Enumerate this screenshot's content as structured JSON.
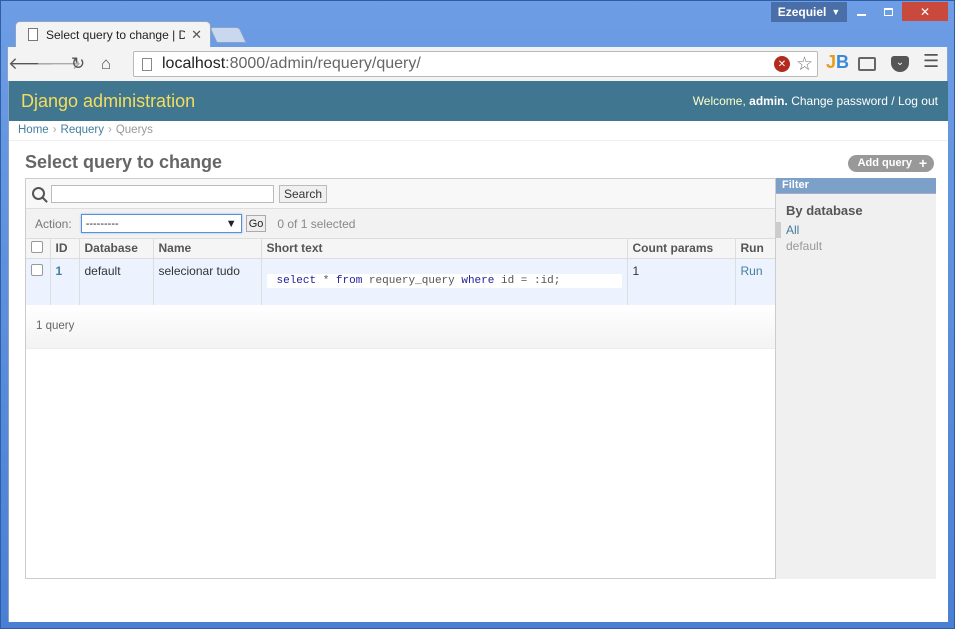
{
  "browser": {
    "user": "Ezequiel",
    "tab_title": "Select query to change | D",
    "url_host": "localhost",
    "url_rest": ":8000/admin/requery/query/"
  },
  "header": {
    "brand": "Django administration",
    "welcome": "Welcome,",
    "username": "admin.",
    "change_password": "Change password",
    "separator": "/",
    "logout": "Log out"
  },
  "breadcrumbs": {
    "home": "Home",
    "app": "Requery",
    "current": "Querys",
    "sep": "›"
  },
  "page": {
    "title": "Select query to change",
    "add_label": "Add query",
    "add_icon": "+"
  },
  "search": {
    "value": "",
    "button": "Search"
  },
  "actions": {
    "label": "Action:",
    "selected": "---------",
    "go": "Go",
    "counter": "0 of 1 selected"
  },
  "table": {
    "columns": [
      "ID",
      "Database",
      "Name",
      "Short text",
      "Count params",
      "Run"
    ],
    "rows": [
      {
        "id": "1",
        "database": "default",
        "name": "selecionar tudo",
        "code_tokens": [
          "select",
          " * ",
          "from",
          " requery_query ",
          "where",
          " id = :id;"
        ],
        "count_params": "1",
        "run": "Run"
      }
    ]
  },
  "paginator": "1 query",
  "filter": {
    "title": "Filter",
    "section": "By database",
    "options": [
      "All",
      "default"
    ],
    "selected": "All"
  },
  "colors": {
    "header_bg": "#417690",
    "brand": "#f5dd5d",
    "link": "#447e9b",
    "row_bg": "#edf3fe"
  }
}
